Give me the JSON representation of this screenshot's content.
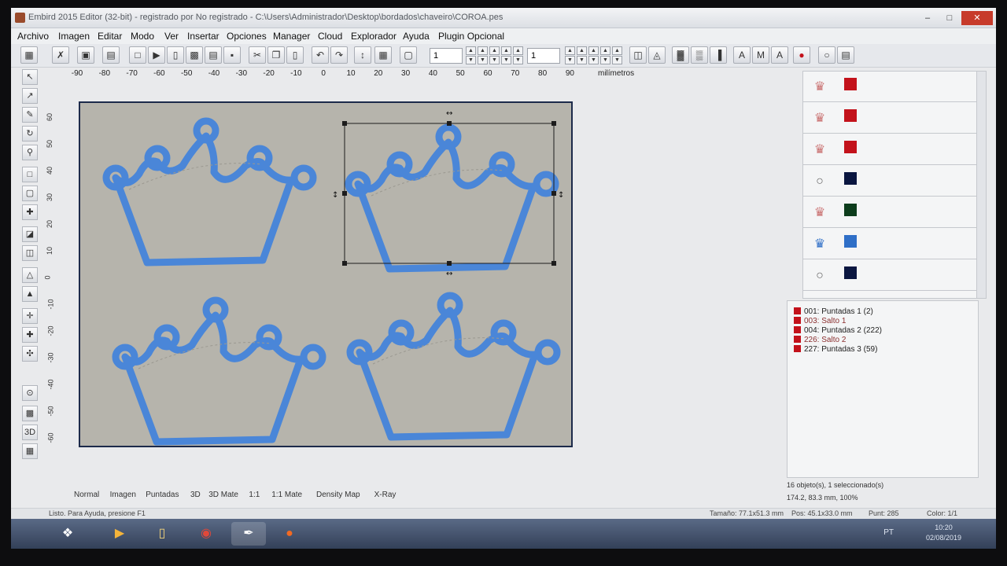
{
  "window": {
    "title": "Embird 2015 Editor (32-bit) - registrado por No registrado - C:\\Users\\Administrador\\Desktop\\bordados\\chaveiro\\COROA.pes"
  },
  "menu": [
    "Archivo",
    "Imagen",
    "Editar",
    "Modo",
    "Ver",
    "Insertar",
    "Opciones",
    "Manager",
    "Cloud",
    "Explorador",
    "Ayuda",
    "Plugin Opcional"
  ],
  "toolbar": {
    "field1": "1",
    "field2": "1"
  },
  "ruler": {
    "horizontal": [
      "-90",
      "-80",
      "-70",
      "-60",
      "-50",
      "-40",
      "-30",
      "-20",
      "-10",
      "0",
      "10",
      "20",
      "30",
      "40",
      "50",
      "60",
      "70",
      "80",
      "90"
    ],
    "unit": "milímetros",
    "vertical": [
      "60",
      "50",
      "40",
      "30",
      "20",
      "10",
      "0",
      "-10",
      "-20",
      "-30",
      "-40",
      "-50",
      "-60"
    ]
  },
  "colors": {
    "stitch": "#4a86d8",
    "canvas": "#b6b4ac"
  },
  "color_list": [
    {
      "icon": "crown-icon",
      "swatch": "#c3121b"
    },
    {
      "icon": "crown-icon",
      "swatch": "#c3121b"
    },
    {
      "icon": "crown-icon",
      "swatch": "#c3121b"
    },
    {
      "icon": "circle-icon",
      "swatch": "#0a1640"
    },
    {
      "icon": "crown-icon",
      "swatch": "#0d3d1c"
    },
    {
      "icon": "crown-icon",
      "swatch": "#2f6fc7"
    },
    {
      "icon": "circle-icon",
      "swatch": "#0a1640"
    }
  ],
  "sequence": [
    {
      "text": "001: Puntadas 1 (2)",
      "jump": false
    },
    {
      "text": "003: Salto 1",
      "jump": true
    },
    {
      "text": "004: Puntadas 2 (222)",
      "jump": false
    },
    {
      "text": "226: Salto 2",
      "jump": true
    },
    {
      "text": "227: Puntadas 3 (59)",
      "jump": false
    }
  ],
  "object_info": "16 objeto(s), 1 seleccionado(s)",
  "dimensions": "174.2, 83.3 mm, 100%",
  "view_tabs": [
    "Normal",
    "Imagen",
    "Puntadas",
    "3D",
    "3D Mate",
    "1:1",
    "1:1 Mate",
    "Density Map",
    "X-Ray"
  ],
  "status": {
    "help": "Listo. Para Ayuda, presione F1",
    "size": "Tamaño: 77.1x51.3 mm",
    "pos": "Pos: 45.1x33.0 mm",
    "stitches": "Punt: 285",
    "color": "Color: 1/1"
  },
  "taskbar": {
    "lang": "PT",
    "time": "10:20",
    "date": "02/08/2019"
  }
}
